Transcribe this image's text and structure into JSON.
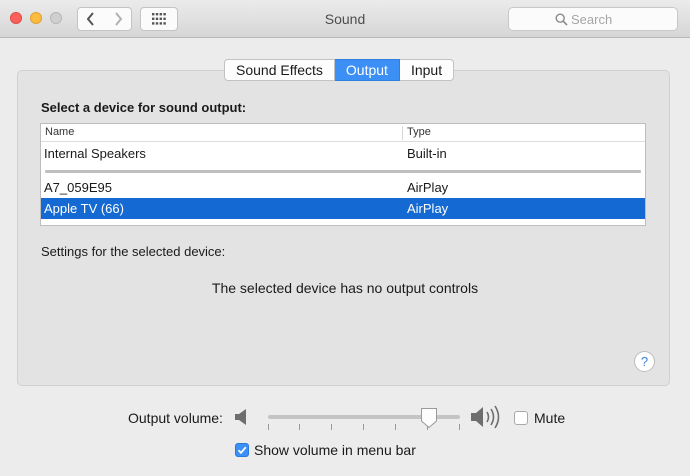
{
  "window": {
    "title": "Sound",
    "search": {
      "placeholder": "Search",
      "value": ""
    }
  },
  "toolbar": {
    "back_icon": "chevron-left-icon",
    "forward_icon": "chevron-right-icon",
    "show_all_icon": "grid-icon"
  },
  "tabs": [
    {
      "label": "Sound Effects",
      "active": false
    },
    {
      "label": "Output",
      "active": true
    },
    {
      "label": "Input",
      "active": false
    }
  ],
  "output": {
    "heading": "Select a device for sound output:",
    "columns": {
      "name": "Name",
      "type": "Type"
    },
    "devices": [
      {
        "name": "Internal Speakers",
        "type": "Built-in",
        "selected": false
      },
      {
        "name": "A7_059E95",
        "type": "AirPlay",
        "selected": false
      },
      {
        "name": "Apple TV (66)",
        "type": "AirPlay",
        "selected": true
      }
    ],
    "settings_label": "Settings for the selected device:",
    "no_controls_message": "The selected device has no output controls",
    "help_label": "?"
  },
  "volume": {
    "label": "Output volume:",
    "level_fraction": 0.84,
    "mute_label": "Mute",
    "mute_checked": false,
    "show_in_menu_bar_label": "Show volume in menu bar",
    "show_in_menu_bar_checked": true
  },
  "colors": {
    "accent": "#3b8ff5",
    "selection": "#1469d2"
  }
}
